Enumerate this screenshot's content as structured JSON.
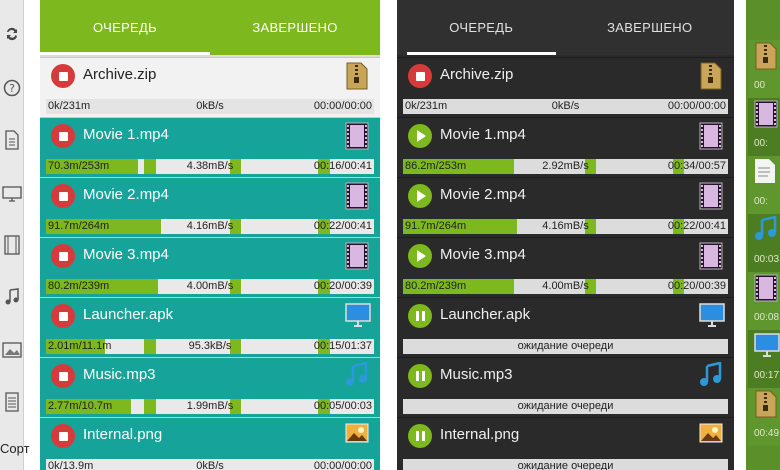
{
  "colors": {
    "accent_green": "#7cb81e",
    "teal_active_row": "#16a39a",
    "stop_red": "#d63b3b",
    "dark_bg": "#2a2a2a"
  },
  "sidebar": {
    "icons": [
      "refresh-icon",
      "help-icon",
      "document-icon",
      "desktop-icon",
      "film-icon",
      "music-icon",
      "image-icon",
      "list-icon"
    ],
    "sort_label": "Сорт"
  },
  "light_panel": {
    "tabs": [
      {
        "label": "ОЧЕРЕДЬ",
        "active": true
      },
      {
        "label": "ЗАВЕРШЕНО",
        "active": false
      }
    ],
    "rows": [
      {
        "name": "Archive.zip",
        "button": "stop",
        "icon": "archive-icon",
        "state": "done",
        "size": "0k/231m",
        "speed": "0kB/s",
        "time": "00:00/00:00",
        "progress": 0
      },
      {
        "name": "Movie 1.mp4",
        "button": "stop",
        "icon": "video-icon",
        "state": "active",
        "size": "70.3m/253m",
        "speed": "4.38mB/s",
        "time": "00:16/00:41",
        "progress": 0.28
      },
      {
        "name": "Movie 2.mp4",
        "button": "stop",
        "icon": "video-icon",
        "state": "active",
        "size": "91.7m/264m",
        "speed": "4.16mB/s",
        "time": "00:22/00:41",
        "progress": 0.35
      },
      {
        "name": "Movie 3.mp4",
        "button": "stop",
        "icon": "video-icon",
        "state": "active",
        "size": "80.2m/239m",
        "speed": "4.00mB/s",
        "time": "00:20/00:39",
        "progress": 0.34
      },
      {
        "name": "Launcher.apk",
        "button": "stop",
        "icon": "monitor-icon",
        "state": "active",
        "size": "2.01m/11.1m",
        "speed": "95.3kB/s",
        "time": "00:15/01:37",
        "progress": 0.18
      },
      {
        "name": "Music.mp3",
        "button": "stop",
        "icon": "music-note-icon",
        "state": "active",
        "size": "2.77m/10.7m",
        "speed": "1.99mB/s",
        "time": "00:05/00:03",
        "progress": 0.26
      },
      {
        "name": "Internal.png",
        "button": "stop",
        "icon": "photo-icon",
        "state": "active",
        "size": "0k/13.9m",
        "speed": "0kB/s",
        "time": "00:00/00:00",
        "progress": 0
      }
    ]
  },
  "dark_panel": {
    "tabs": [
      {
        "label": "ОЧЕРЕДЬ",
        "active": true
      },
      {
        "label": "ЗАВЕРШЕНО",
        "active": false
      }
    ],
    "rows": [
      {
        "name": "Archive.zip",
        "button": "stop",
        "icon": "archive-icon",
        "state": "progress",
        "size": "0k/231m",
        "speed": "0kB/s",
        "time": "00:00/00:00",
        "progress": 0
      },
      {
        "name": "Movie 1.mp4",
        "button": "play",
        "icon": "video-icon",
        "state": "progress",
        "size": "86.2m/253m",
        "speed": "2.92mB/s",
        "time": "00:34/00:57",
        "progress": 0.34
      },
      {
        "name": "Movie 2.mp4",
        "button": "play",
        "icon": "video-icon",
        "state": "progress",
        "size": "91.7m/264m",
        "speed": "4.16mB/s",
        "time": "00:22/00:41",
        "progress": 0.35
      },
      {
        "name": "Movie 3.mp4",
        "button": "play",
        "icon": "video-icon",
        "state": "progress",
        "size": "80.2m/239m",
        "speed": "4.00mB/s",
        "time": "00:20/00:39",
        "progress": 0.34
      },
      {
        "name": "Launcher.apk",
        "button": "pause",
        "icon": "monitor-icon",
        "state": "waiting",
        "wait_text": "ожидание очереди"
      },
      {
        "name": "Music.mp3",
        "button": "pause",
        "icon": "music-note-icon",
        "state": "waiting",
        "wait_text": "ожидание очереди"
      },
      {
        "name": "Internal.png",
        "button": "pause",
        "icon": "photo-icon",
        "state": "waiting",
        "wait_text": "ожидание очереди"
      }
    ]
  },
  "right_strip": {
    "labels": [
      "00",
      "00:",
      "00:",
      "00:03",
      "00:08",
      "00:17",
      "00:49"
    ]
  }
}
